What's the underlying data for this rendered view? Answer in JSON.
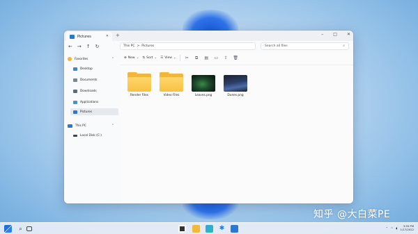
{
  "window": {
    "tab_title": "Pictures",
    "new_tab": "+",
    "controls": [
      "–",
      "□",
      "✕"
    ]
  },
  "address": {
    "nav": [
      "←",
      "→",
      "↑",
      "↻"
    ],
    "path": [
      "This PC",
      ">",
      "Pictures"
    ],
    "search_placeholder": "Search all files"
  },
  "sidebar": {
    "favorites_label": "Favorites",
    "favorites": [
      {
        "label": "Desktop",
        "icon": "desktop-icon"
      },
      {
        "label": "Documents",
        "icon": "documents-icon"
      },
      {
        "label": "Downloads",
        "icon": "downloads-icon"
      },
      {
        "label": "Applications",
        "icon": "applications-icon"
      },
      {
        "label": "Pictures",
        "icon": "pictures-icon",
        "selected": true
      }
    ],
    "thispc_label": "This PC",
    "drives": [
      {
        "label": "Local Disk (C:)",
        "icon": "disk-icon"
      }
    ]
  },
  "toolbar": {
    "new_label": "New",
    "sort_label": "Sort",
    "view_label": "View",
    "actions": [
      "cut-icon",
      "copy-icon",
      "paste-icon",
      "share-icon",
      "rename-icon",
      "delete-icon"
    ]
  },
  "files": [
    {
      "name": "Render Files",
      "kind": "folder"
    },
    {
      "name": "Video Files",
      "kind": "folder"
    },
    {
      "name": "Leaves.png",
      "kind": "image-leaves"
    },
    {
      "name": "Dunes.png",
      "kind": "image-dunes"
    }
  ],
  "taskbar": {
    "time": "3:55 PM",
    "date": "1/17/2022"
  },
  "watermark": "知乎 @大白菜PE",
  "colors": {
    "accent": "#2a78d6",
    "folder": "#f0b73a",
    "wallpaper": "#8dbde6"
  }
}
